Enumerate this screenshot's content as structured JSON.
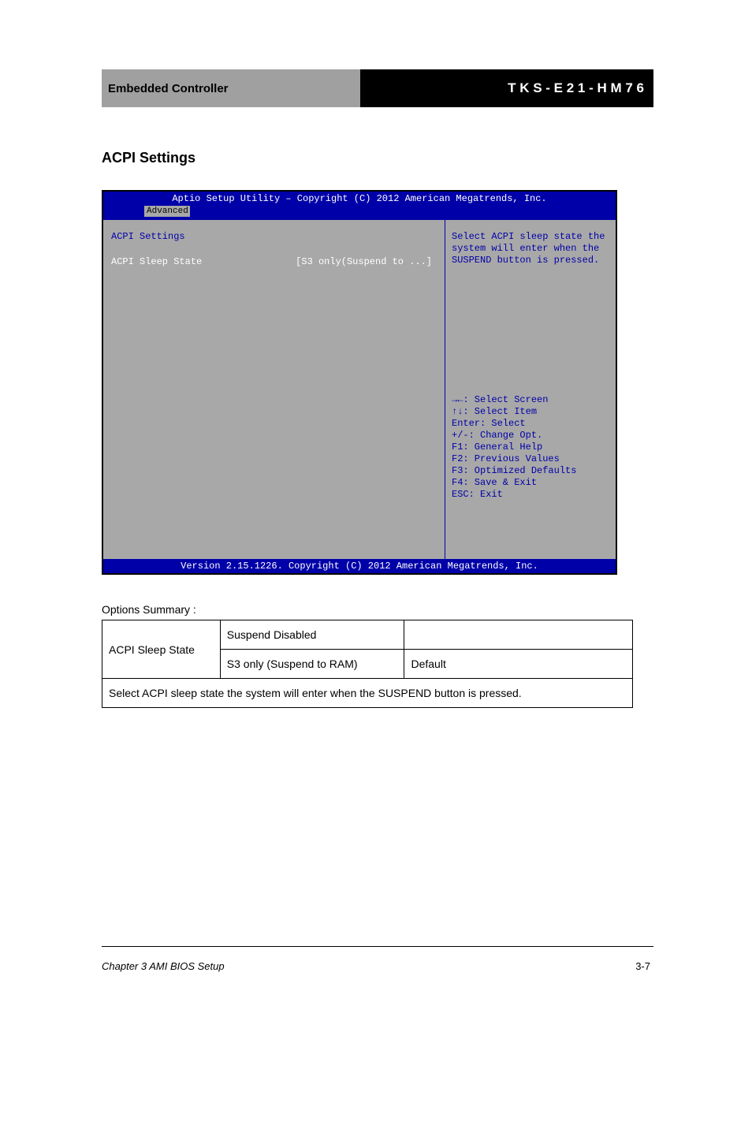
{
  "header": {
    "left": "Embedded Controller",
    "right": "T K S - E 2 1 - H M 7 6"
  },
  "subtitle": "ACPI Settings",
  "bios": {
    "title": "Aptio Setup Utility – Copyright (C) 2012 American Megatrends, Inc.",
    "tab": "Advanced",
    "section": "ACPI Settings",
    "item_label": "ACPI Sleep State",
    "item_value": "[S3 only(Suspend to ...]",
    "desc_line1": "Select ACPI sleep state the",
    "desc_line2": "system will enter when the",
    "desc_line3": "SUSPEND button is pressed.",
    "keys": {
      "l1": "→←: Select Screen",
      "l2": "↑↓: Select Item",
      "l3": "Enter: Select",
      "l4": "+/-: Change Opt.",
      "l5": "F1: General Help",
      "l6": "F2: Previous Values",
      "l7": "F3: Optimized Defaults",
      "l8": "F4: Save & Exit",
      "l9": "ESC: Exit"
    },
    "footer": "Version 2.15.1226. Copyright (C) 2012 American Megatrends, Inc."
  },
  "section_label": "Options Summary :",
  "table": {
    "r1c1": "ACPI Sleep State",
    "r1c2": "Suspend Disabled",
    "r1c3": "",
    "r2c2": "S3 only (Suspend to RAM)",
    "r2c3": "Default",
    "r3": "Select ACPI sleep state the system will enter when the SUSPEND button is pressed."
  },
  "footer_text": "Chapter 3 AMI BIOS Setup",
  "page_number": "3-7"
}
